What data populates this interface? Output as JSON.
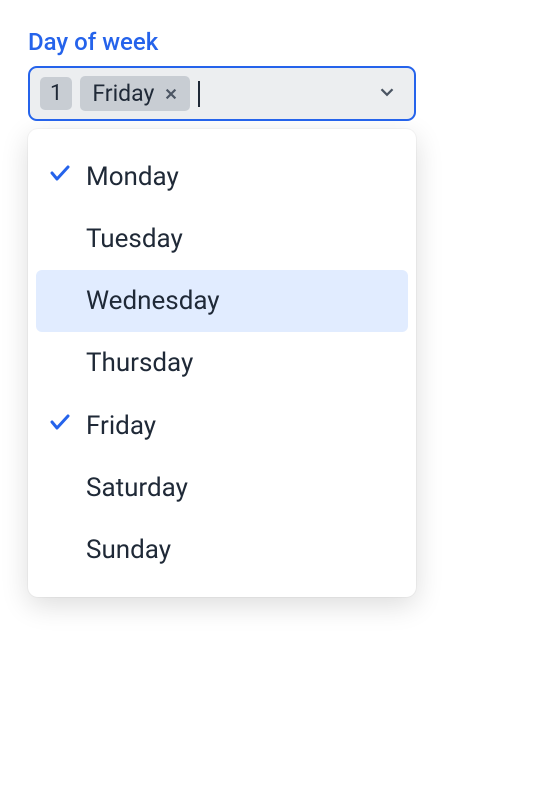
{
  "field": {
    "label": "Day of week",
    "tag_count": "1",
    "selected_tag": "Friday"
  },
  "options": [
    {
      "label": "Monday",
      "selected": true,
      "highlighted": false
    },
    {
      "label": "Tuesday",
      "selected": false,
      "highlighted": false
    },
    {
      "label": "Wednesday",
      "selected": false,
      "highlighted": true
    },
    {
      "label": "Thursday",
      "selected": false,
      "highlighted": false
    },
    {
      "label": "Friday",
      "selected": true,
      "highlighted": false
    },
    {
      "label": "Saturday",
      "selected": false,
      "highlighted": false
    },
    {
      "label": "Sunday",
      "selected": false,
      "highlighted": false
    }
  ],
  "colors": {
    "accent": "#2563eb",
    "tag_bg": "#c8cdd3",
    "control_bg": "#eceef0",
    "highlight_bg": "#e1ecff",
    "text": "#1f2937"
  }
}
